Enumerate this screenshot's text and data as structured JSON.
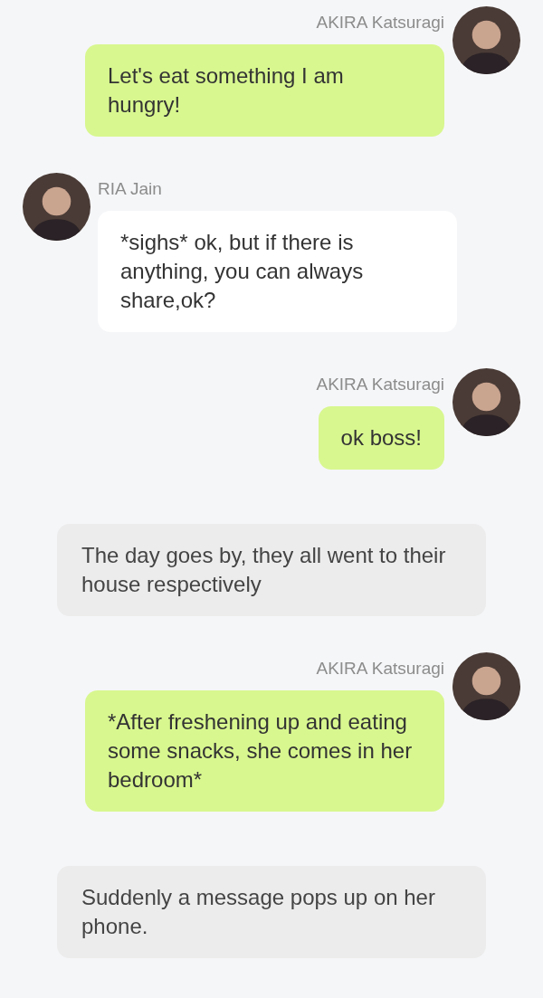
{
  "messages": [
    {
      "kind": "right",
      "speaker": "AKIRA Katsuragi",
      "text": "Let's eat something I am hungry!"
    },
    {
      "kind": "left",
      "speaker": "RIA Jain",
      "text": "*sighs* ok, but if there is anything, you can always share,ok?"
    },
    {
      "kind": "right",
      "speaker": "AKIRA Katsuragi",
      "text": "ok boss!"
    },
    {
      "kind": "narration",
      "text": "The day goes by, they all went to their house respectively"
    },
    {
      "kind": "right",
      "speaker": "AKIRA Katsuragi",
      "text": "*After freshening up and eating some snacks, she comes in her bedroom*"
    },
    {
      "kind": "narration",
      "text": "Suddenly a message pops up on her phone."
    }
  ]
}
